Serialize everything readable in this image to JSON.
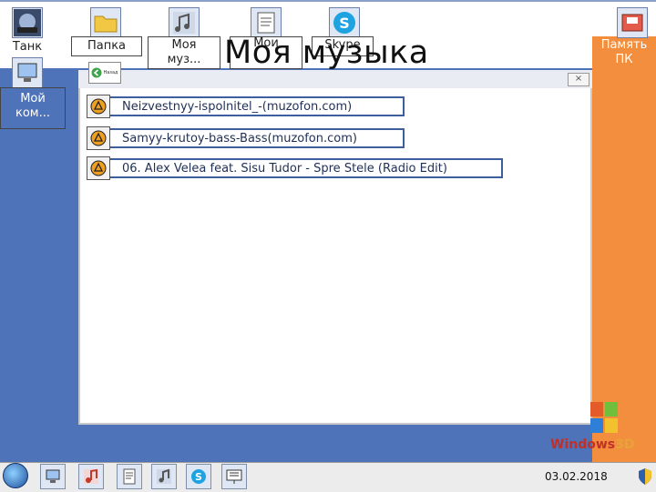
{
  "window_title": "Моя музыка",
  "desktop_icons": [
    {
      "label": "Танк",
      "icon": "tank-game-icon"
    },
    {
      "label": "Папка",
      "icon": "folder-icon"
    },
    {
      "label": "Моя муз...",
      "icon": "music-folder-icon"
    },
    {
      "label": "Мои",
      "icon": "documents-icon"
    },
    {
      "label": "Skype",
      "icon": "skype-icon"
    },
    {
      "label": "Мой ком...",
      "icon": "computer-icon"
    },
    {
      "label": "Память ПК",
      "icon": "memory-icon"
    }
  ],
  "window": {
    "back_label": "Назад",
    "close_label": "×",
    "tracks": [
      "Neizvestnyy-ispolnitel_-(muzofon.com)",
      "Samyy-krutoy-bass-Bass(muzofon.com)",
      "06. Alex Velea feat. Sisu Tudor - Spre Stele (Radio Edit)"
    ]
  },
  "logo": {
    "text_main": "Windows",
    "text_accent": "3D"
  },
  "taskbar": {
    "date": "03.02.2018",
    "items": [
      "computer-icon",
      "music-icon",
      "documents-icon",
      "music-folder-icon",
      "skype-icon",
      "presentation-icon"
    ]
  },
  "colors": {
    "desktop": "#4f73b8",
    "accent": "#f28e3d",
    "track_border": "#3e5f9e",
    "logo": "#c03028"
  }
}
